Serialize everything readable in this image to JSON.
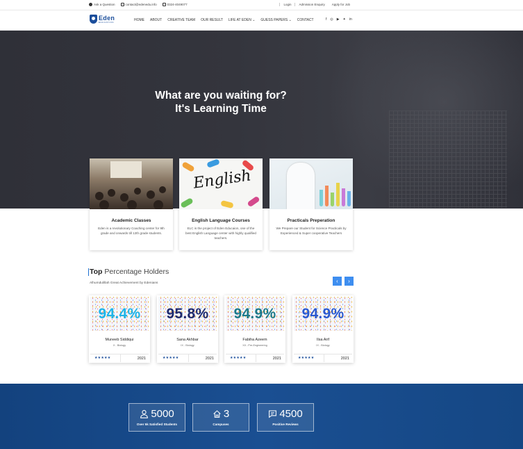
{
  "topbar": {
    "ask": "Ask a Question",
    "email": "contact@edenedu.info",
    "phone": "0324-4049077",
    "login": "Login",
    "admission": "Admission Enquiry",
    "apply": "Apply for Job"
  },
  "logo": {
    "name": "Eden",
    "tagline": "EDUCATION"
  },
  "nav": {
    "items": [
      "HOME",
      "ABOUT",
      "CREATIVE TEAM",
      "OUR RESULT",
      "LIFE AT EDEN ⌄",
      "GUESS PAPERS ⌄",
      "CONTACT"
    ]
  },
  "social": {
    "facebook": "f",
    "instagram": "◎",
    "youtube": "▶",
    "twitter": "✦",
    "linkedin": "in"
  },
  "hero": {
    "line1": "What are you waiting for?",
    "line2": "It's Learning Time"
  },
  "cards": [
    {
      "title": "Academic Classes",
      "text": "Eden is a revolutionary Coaching center for 9th grade and onwards till 12th grade students."
    },
    {
      "title": "English Language Courses",
      "text": "ELC is the project of Eden Educaion, one of the best English Language center with highly qualified teachers."
    },
    {
      "title": "Practicals Preperation",
      "text": "We Prepare our Student for Science Practicals by Experienced & Super cooperative Teachers"
    }
  ],
  "holders": {
    "title_bold": "Top",
    "title_rest": " Percentage Holders",
    "subtitle": "Alhumdulillah Great Achievement by Edenians",
    "prev": "‹",
    "next": "›",
    "items": [
      {
        "pct": "94.4%",
        "name": "Muneeb Siddiqui",
        "cls": "X - Biology",
        "stars": "★★★★★",
        "year": "2021",
        "color": "#1fb4e8"
      },
      {
        "pct": "95.8%",
        "name": "Sana Akhbar",
        "cls": "IX - Biology",
        "stars": "★★★★★",
        "year": "2021",
        "color": "#1f2a6e"
      },
      {
        "pct": "94.9%",
        "name": "Fabiha Azeem",
        "cls": "XII - Pre-Engineering",
        "stars": "★★★★★",
        "year": "2021",
        "color": "#1d7a8a"
      },
      {
        "pct": "94.9%",
        "name": "Ilsa Arif",
        "cls": "IX - Biology",
        "stars": "★★★★★",
        "year": "2021",
        "color": "#2b59d0"
      }
    ]
  },
  "stats": [
    {
      "icon": "user-icon",
      "value": "5000",
      "label": "Over 5k Satisfied Students"
    },
    {
      "icon": "home-icon",
      "value": "3",
      "label": "Campuses"
    },
    {
      "icon": "chat-icon",
      "value": "4500",
      "label": "Positive Reviews"
    }
  ]
}
